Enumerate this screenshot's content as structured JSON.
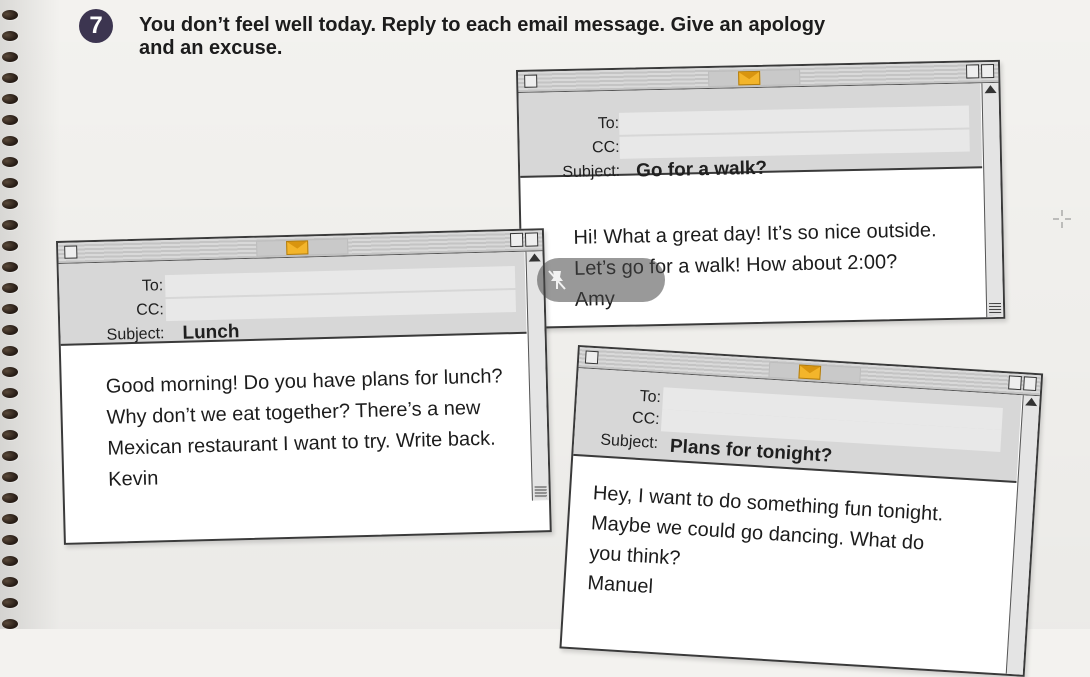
{
  "exercise": {
    "number": "7",
    "instruction_line1": "You don’t feel well today. Reply to each email message. Give an apology",
    "instruction_line2": "and an excuse."
  },
  "header_labels": {
    "to": "To:",
    "cc": "CC:",
    "subject": "Subject:"
  },
  "emails": [
    {
      "subject": "Go for a walk?",
      "to": "",
      "cc": "",
      "body": [
        "Hi! What a great day! It’s so nice outside.",
        "Let’s go for a walk! How about 2:00?"
      ],
      "signature": "Amy"
    },
    {
      "subject": "Lunch",
      "to": "",
      "cc": "",
      "body": [
        "Good morning! Do you have plans for lunch?",
        "Why don’t we eat together? There’s a new",
        "Mexican restaurant I want to try. Write back."
      ],
      "signature": "Kevin"
    },
    {
      "subject": "Plans for tonight?",
      "to": "",
      "cc": "",
      "body": [
        "Hey, I want to do something fun tonight.",
        "Maybe we could go dancing. What do",
        "you think?"
      ],
      "signature": "Manuel"
    }
  ],
  "icons": [
    "mail-icon",
    "pin-off-icon",
    "crosshair-icon"
  ],
  "colors": {
    "number_badge": "#3c3550",
    "mail_icon": "#f3b52b",
    "header_bg": "#d7d7d7"
  }
}
